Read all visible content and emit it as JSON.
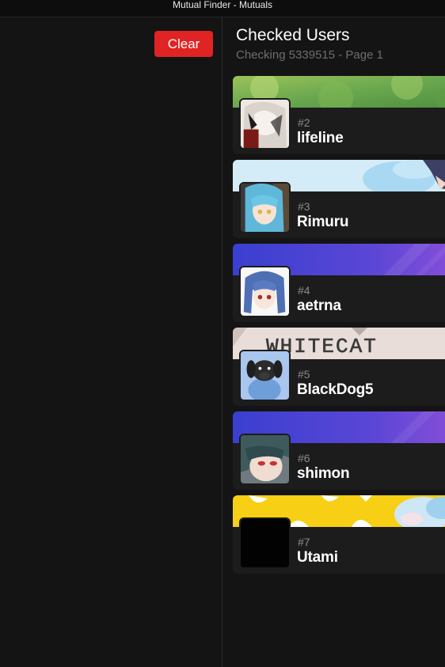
{
  "window": {
    "title": "Mutual Finder - Mutuals"
  },
  "toolbar": {
    "clear_label": "Clear"
  },
  "panel": {
    "title": "Checked Users",
    "subtitle": "Checking 5339515 - Page 1"
  },
  "users": [
    {
      "rank": "#2",
      "name": "lifeline"
    },
    {
      "rank": "#3",
      "name": "Rimuru"
    },
    {
      "rank": "#4",
      "name": "aetrna"
    },
    {
      "rank": "#5",
      "name": "BlackDog5",
      "banner_text": "WHITECAT"
    },
    {
      "rank": "#6",
      "name": "shimon"
    },
    {
      "rank": "#7",
      "name": "Utami"
    }
  ],
  "colors": {
    "accent_danger": "#e02323",
    "background": "#141414",
    "card": "#1c1c1c",
    "muted_text": "#6e6e6e"
  }
}
